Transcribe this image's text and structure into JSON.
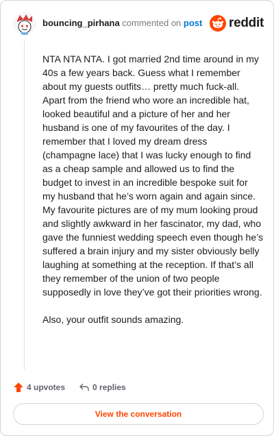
{
  "header": {
    "username": "bouncing_pirhana",
    "commented_text": "commented on",
    "post_link": "post",
    "logo_text": "reddit"
  },
  "comment": {
    "paragraphs": [
      "NTA NTA NTA. I got married 2nd time around in my 40s a few years back. Guess what I remember about my guests outfits… pretty much fuck-all. Apart from the friend who wore an incredible hat, looked beautiful and a picture of her and her husband is one of my favourites of the day. I remember that I loved my dream dress (champagne lace) that I was lucky enough to find as a cheap sample and allowed us to find the budget to invest in an incredible bespoke suit for my husband that he’s worn again and again since. My favourite pictures are of my mum looking proud and slightly awkward in her fascinator, my dad, who gave the funniest wedding speech even though he’s suffered a brain injury and my sister obviously belly laughing at something at the reception. If that’s all they remember of the union of two people supposedly in love they’ve got their priorities wrong.",
      "Also, your outfit sounds amazing."
    ]
  },
  "actions": {
    "upvotes": "4 upvotes",
    "replies": "0 replies"
  },
  "cta": {
    "label": "View the conversation"
  },
  "colors": {
    "accent": "#ff4500",
    "link": "#0079d3"
  }
}
